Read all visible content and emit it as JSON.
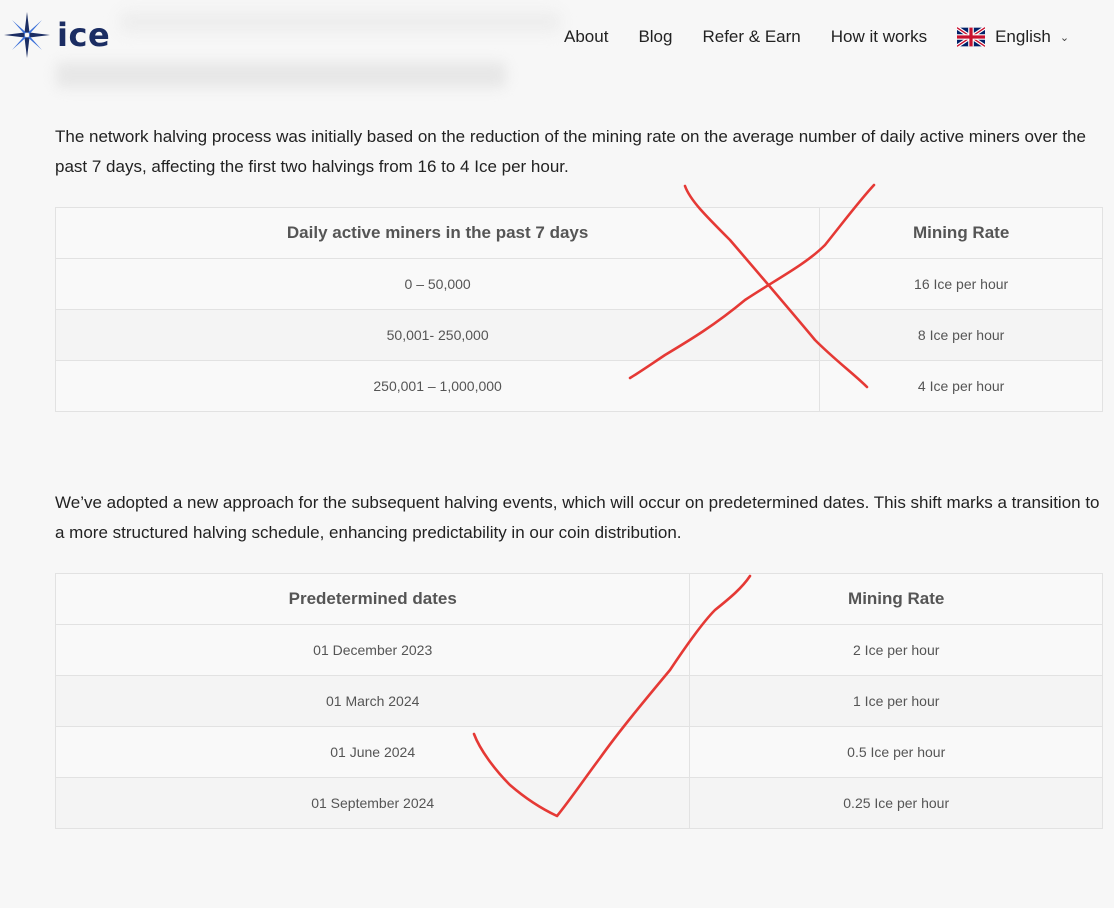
{
  "header": {
    "logo_text": "ice",
    "nav": [
      "About",
      "Blog",
      "Refer & Earn",
      "How it works"
    ],
    "language": {
      "label": "English",
      "flag_icon": "uk-flag-icon"
    }
  },
  "section1": {
    "paragraph": "The network halving process was initially based on the reduction of the mining rate on the average number of daily active miners over the past 7 days, affecting the first two halvings from 16 to 4 Ice per hour.",
    "table": {
      "headers": [
        "Daily active miners in the past 7 days",
        "Mining Rate"
      ],
      "rows": [
        [
          "0 – 50,000",
          "16 Ice per hour"
        ],
        [
          "50,001- 250,000",
          "8 Ice per hour"
        ],
        [
          "250,001 – 1,000,000",
          "4 Ice per hour"
        ]
      ]
    }
  },
  "section2": {
    "paragraph": "We’ve adopted a new approach for the subsequent halving events, which will occur on predetermined dates. This shift marks a transition to a more structured halving schedule, enhancing predictability in our coin distribution.",
    "table": {
      "headers": [
        "Predetermined dates",
        "Mining Rate"
      ],
      "rows": [
        [
          "01 December 2023",
          "2 Ice per hour"
        ],
        [
          "01 March 2024",
          "1 Ice per hour"
        ],
        [
          "01 June 2024",
          "0.5 Ice per hour"
        ],
        [
          "01 September 2024",
          "0.25 Ice per hour"
        ]
      ]
    }
  },
  "colors": {
    "brand": "#1b2d63",
    "annotation": "#e53935"
  }
}
